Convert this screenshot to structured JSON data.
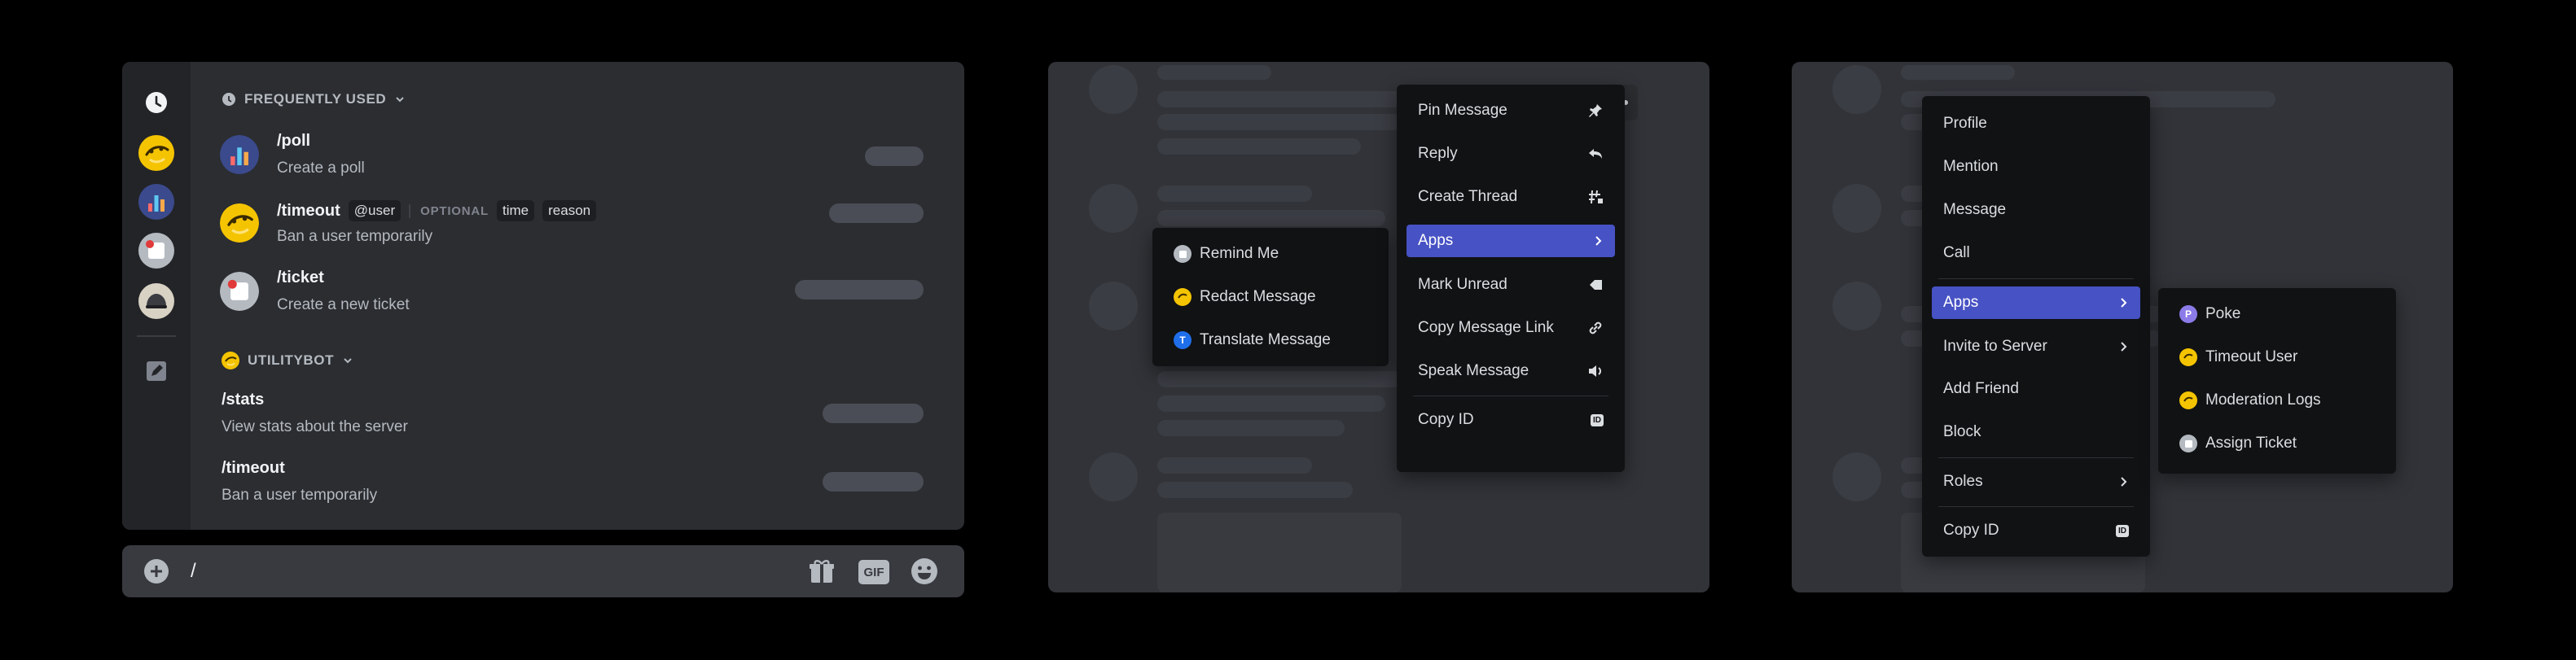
{
  "picker": {
    "frequently_used": {
      "header": "FREQUENTLY USED",
      "commands": [
        {
          "name": "/poll",
          "description": "Create a poll"
        },
        {
          "name": "/timeout",
          "description": "Ban a user temporarily",
          "args": [
            "@user"
          ],
          "optional_label": "OPTIONAL",
          "optional_args": [
            "time",
            "reason"
          ]
        },
        {
          "name": "/ticket",
          "description": "Create a new ticket"
        }
      ]
    },
    "utilitybot": {
      "header": "UTILITYBOT",
      "commands": [
        {
          "name": "/stats",
          "description": "View stats about the server"
        },
        {
          "name": "/timeout",
          "description": "Ban a user temporarily"
        }
      ]
    },
    "rail_icons": [
      "clock-icon",
      "utilitybot-avatar",
      "poll-bot-avatar",
      "ticket-bot-avatar",
      "helmet-bot-avatar",
      "edit-icon"
    ]
  },
  "composer": {
    "value": "/",
    "icons": [
      "add-icon",
      "gift-icon",
      "gif-icon",
      "emoji-icon"
    ],
    "gif_label": "GIF"
  },
  "message_menu": {
    "items": [
      {
        "label": "Pin Message",
        "icon": "pin-icon"
      },
      {
        "label": "Reply",
        "icon": "reply-icon"
      },
      {
        "label": "Create Thread",
        "icon": "thread-icon"
      },
      {
        "label": "Apps",
        "icon": "chevron-right-icon",
        "active": true
      },
      {
        "label": "Mark Unread",
        "icon": "mark-unread-icon"
      },
      {
        "label": "Copy Message Link",
        "icon": "link-icon"
      },
      {
        "label": "Speak Message",
        "icon": "speaker-icon"
      },
      {
        "label": "Copy ID",
        "icon": "id-icon",
        "id_label": "ID"
      }
    ],
    "apps_submenu": [
      {
        "label": "Remind Me",
        "icon": "remind-bot-avatar"
      },
      {
        "label": "Redact Message",
        "icon": "utilitybot-avatar"
      },
      {
        "label": "Translate Message",
        "icon": "translate-bot-avatar",
        "badge": "T"
      }
    ]
  },
  "user_menu": {
    "items": [
      {
        "label": "Profile"
      },
      {
        "label": "Mention"
      },
      {
        "label": "Message"
      },
      {
        "label": "Call"
      },
      {
        "label": "Apps",
        "active": true
      },
      {
        "label": "Invite to Server"
      },
      {
        "label": "Add Friend"
      },
      {
        "label": "Block"
      },
      {
        "label": "Roles"
      },
      {
        "label": "Copy ID",
        "id_label": "ID"
      }
    ],
    "apps_submenu": [
      {
        "label": "Poke",
        "icon": "poke-bot-avatar",
        "badge": "P"
      },
      {
        "label": "Timeout User",
        "icon": "utilitybot-avatar"
      },
      {
        "label": "Moderation Logs",
        "icon": "utilitybot-avatar"
      },
      {
        "label": "Assign Ticket",
        "icon": "remind-bot-avatar"
      }
    ]
  },
  "colors": {
    "accent": "#4752c4",
    "background": "#000000",
    "panel": "#2b2d31",
    "menu": "#111214",
    "skeleton": "#3b3d44"
  }
}
